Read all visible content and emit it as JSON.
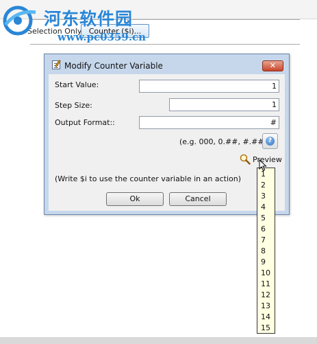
{
  "background": {
    "selection_only_label": "Selection Only",
    "counter_button_label": "Counter ($i)..."
  },
  "watermark": {
    "title": "河东软件园",
    "url": "www.pc0359.cn"
  },
  "dialog": {
    "title": "Modify Counter Variable",
    "close_glyph": "✕",
    "start_value_label": "Start Value:",
    "start_value": "1",
    "step_size_label": "Step Size:",
    "step_size": "1",
    "output_format_label": "Output Format::",
    "output_format": "#",
    "format_example": "(e.g. 000, 0.##, #.##)",
    "help_glyph": "?",
    "preview_label": "Preview",
    "hint": "(Write $i to use the counter variable in an action)",
    "ok_label": "Ok",
    "cancel_label": "Cancel"
  },
  "preview_values": [
    "1",
    "2",
    "3",
    "4",
    "5",
    "6",
    "7",
    "8",
    "9",
    "10",
    "11",
    "12",
    "13",
    "14",
    "15"
  ],
  "icons": {
    "title": "edit-document-icon",
    "close": "close-icon",
    "help": "help-icon",
    "preview": "magnifier-icon",
    "cursor": "mouse-cursor-icon"
  },
  "colors": {
    "dialog_frame": "#c6d7ec",
    "close_button": "#c8452c",
    "preview_bg": "#ffffe1",
    "watermark": "#2a86d6"
  }
}
